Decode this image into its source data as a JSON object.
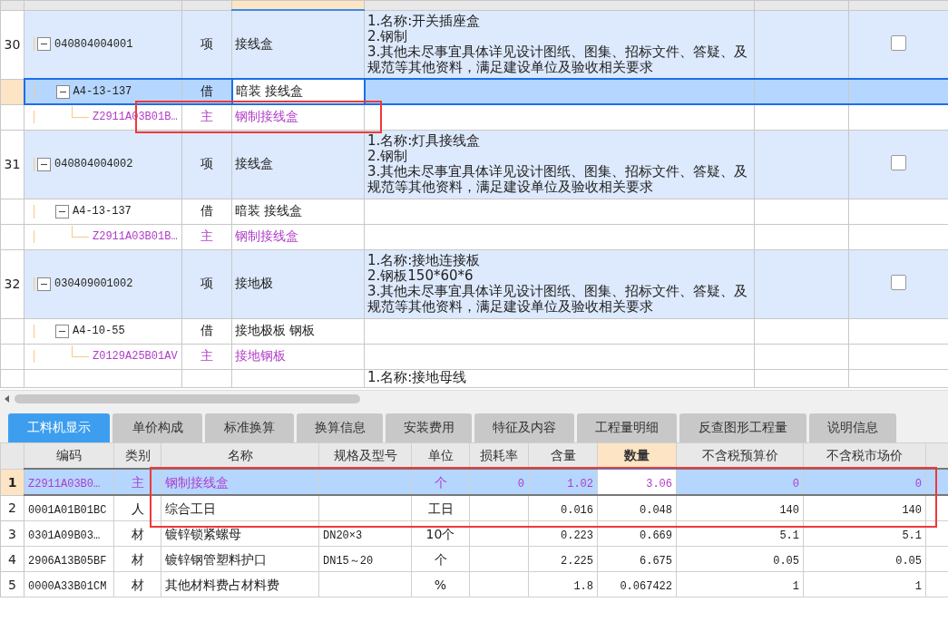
{
  "top_table": {
    "columns": [
      {
        "selected": false
      },
      {
        "selected": false
      },
      {
        "selected": false
      },
      {
        "selected": true
      },
      {
        "selected": false
      },
      {
        "selected": false
      },
      {
        "selected": false
      }
    ],
    "rows": [
      {
        "kind": "item",
        "number": "30",
        "code": "040804004001",
        "type": "项",
        "name": "接线盒",
        "features": [
          "1.名称:开关插座盒",
          "2.钢制",
          "3.其他未尽事宜具体详见设计图纸、图集、招标文件、答疑、及规范等其他资料，满足建设单位及验收相关要求"
        ],
        "checked": false,
        "selected": false,
        "highlighted": false,
        "expanded": true,
        "children": [
          {
            "kind": "quota",
            "code": "A4-13-137",
            "type": "借",
            "name": "暗装 接线盒",
            "selected": true,
            "highlighted": false,
            "expanded": true,
            "children": [
              {
                "kind": "material",
                "code": "Z2911A03B01B…",
                "type": "主",
                "name": "钢制接线盒",
                "selected": false,
                "highlighted": true
              }
            ]
          }
        ]
      },
      {
        "kind": "item",
        "number": "31",
        "code": "040804004002",
        "type": "项",
        "name": "接线盒",
        "features": [
          "1.名称:灯具接线盒",
          "2.钢制",
          "3.其他未尽事宜具体详见设计图纸、图集、招标文件、答疑、及规范等其他资料，满足建设单位及验收相关要求"
        ],
        "checked": false,
        "selected": false,
        "highlighted": false,
        "expanded": true,
        "children": [
          {
            "kind": "quota",
            "code": "A4-13-137",
            "type": "借",
            "name": "暗装 接线盒",
            "selected": false,
            "highlighted": false,
            "expanded": true,
            "children": [
              {
                "kind": "material",
                "code": "Z2911A03B01B…",
                "type": "主",
                "name": "钢制接线盒",
                "selected": false,
                "highlighted": false
              }
            ]
          }
        ]
      },
      {
        "kind": "item",
        "number": "32",
        "code": "030409001002",
        "type": "项",
        "name": "接地极",
        "features": [
          "1.名称:接地连接板",
          "2.钢板150*60*6",
          "3.其他未尽事宜具体详见设计图纸、图集、招标文件、答疑、及规范等其他资料，满足建设单位及验收相关要求"
        ],
        "checked": false,
        "selected": false,
        "highlighted": false,
        "expanded": true,
        "children": [
          {
            "kind": "quota",
            "code": "A4-10-55",
            "type": "借",
            "name": "接地极板 钢板",
            "selected": false,
            "highlighted": false,
            "expanded": true,
            "children": [
              {
                "kind": "material",
                "code": "Z0129A25B01AV",
                "type": "主",
                "name": "接地钢板",
                "selected": false,
                "highlighted": false
              }
            ]
          }
        ]
      },
      {
        "kind": "partial",
        "features": [
          "1.名称:接地母线"
        ]
      }
    ]
  },
  "tabs": [
    {
      "label": "工料机显示",
      "selected": true
    },
    {
      "label": "单价构成",
      "selected": false
    },
    {
      "label": "标准换算",
      "selected": false
    },
    {
      "label": "换算信息",
      "selected": false
    },
    {
      "label": "安装费用",
      "selected": false
    },
    {
      "label": "特征及内容",
      "selected": false
    },
    {
      "label": "工程量明细",
      "selected": false
    },
    {
      "label": "反查图形工程量",
      "selected": false
    },
    {
      "label": "说明信息",
      "selected": false
    }
  ],
  "bottom_table": {
    "columns": [
      {
        "label": "编码",
        "selected": false
      },
      {
        "label": "类别",
        "selected": false
      },
      {
        "label": "名称",
        "selected": false
      },
      {
        "label": "规格及型号",
        "selected": false
      },
      {
        "label": "单位",
        "selected": false
      },
      {
        "label": "损耗率",
        "selected": false
      },
      {
        "label": "含量",
        "selected": false
      },
      {
        "label": "数量",
        "selected": true
      },
      {
        "label": "不含税预算价",
        "selected": false
      },
      {
        "label": "不含税市场价",
        "selected": false
      }
    ],
    "rows": [
      {
        "kind": "material",
        "number": "1",
        "cells": [
          "Z2911A03B0…",
          "主",
          "钢制接线盒",
          "",
          "个",
          "0",
          "1.02",
          "3.06",
          "0",
          "0"
        ],
        "selected": true,
        "highlighted": true
      },
      {
        "kind": "labor",
        "number": "2",
        "cells": [
          "0001A01B01BC",
          "人",
          "综合工日",
          "",
          "工日",
          "",
          "0.016",
          "0.048",
          "140",
          "140"
        ],
        "selected": false,
        "highlighted": true
      },
      {
        "kind": "stuff",
        "number": "3",
        "cells": [
          "0301A09B03…",
          "材",
          "镀锌锁紧螺母",
          "DN20×3",
          "10个",
          "",
          "0.223",
          "0.669",
          "5.1",
          "5.1"
        ],
        "selected": false,
        "highlighted": false
      },
      {
        "kind": "stuff",
        "number": "4",
        "cells": [
          "2906A13B05BF",
          "材",
          "镀锌钢管塑料护口",
          "DN15～20",
          "个",
          "",
          "2.225",
          "6.675",
          "0.05",
          "0.05"
        ],
        "selected": false,
        "highlighted": false
      },
      {
        "kind": "stuff",
        "number": "5",
        "cells": [
          "0000A33B01CM",
          "材",
          "其他材料费占材料费",
          "",
          "%",
          "",
          "1.8",
          "0.067422",
          "1",
          "1"
        ],
        "selected": false,
        "highlighted": false
      }
    ]
  }
}
